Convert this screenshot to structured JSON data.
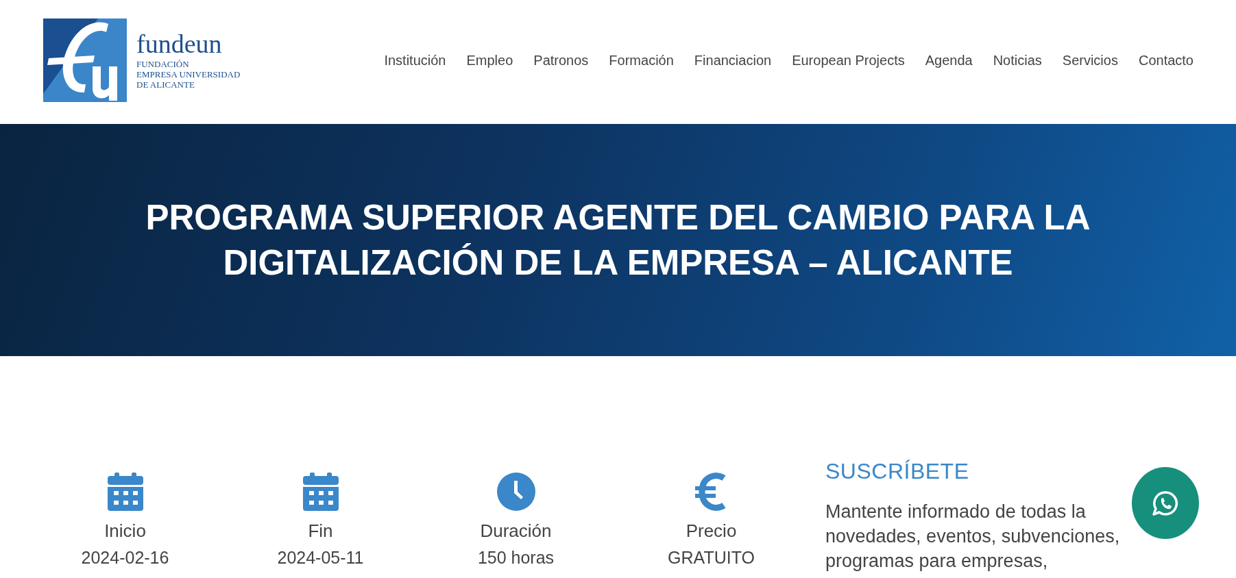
{
  "logo": {
    "name": "fundeun",
    "subtitle_lines": [
      "FUNDACIÓN",
      "EMPRESA UNIVERSIDAD",
      "DE ALICANTE"
    ]
  },
  "nav": [
    "Institución",
    "Empleo",
    "Patronos",
    "Formación",
    "Financiacion",
    "European Projects",
    "Agenda",
    "Noticias",
    "Servicios",
    "Contacto"
  ],
  "hero": {
    "title_lines": [
      "PROGRAMA SUPERIOR AGENTE DEL CAMBIO PARA LA",
      "DIGITALIZACIÓN DE LA EMPRESA – ALICANTE"
    ]
  },
  "facts": [
    {
      "kind": "calendar",
      "label": "Inicio",
      "value": "2024-02-16"
    },
    {
      "kind": "calendar",
      "label": "Fin",
      "value": "2024-05-11"
    },
    {
      "kind": "clock",
      "label": "Duración",
      "value": "150 horas"
    },
    {
      "kind": "euro",
      "label": "Precio",
      "value": "GRATUITO"
    }
  ],
  "subscribe": {
    "title": "SUSCRÍBETE",
    "text": "Mantente informado de todas la novedades, eventos, subvenciones, programas para empresas,"
  }
}
